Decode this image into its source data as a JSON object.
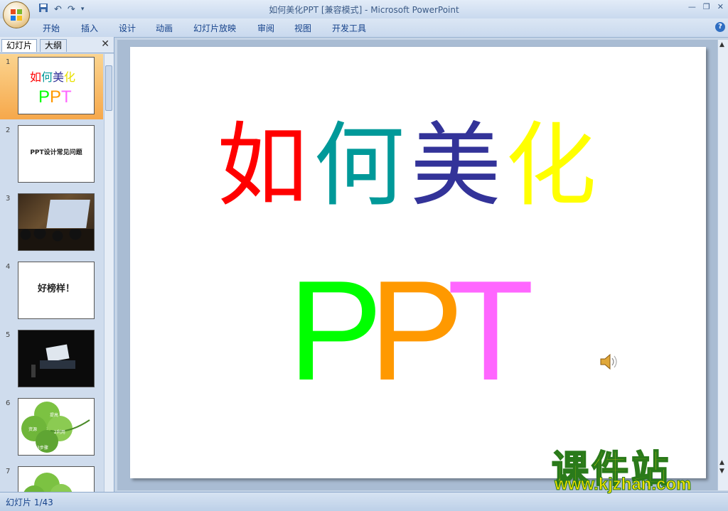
{
  "window": {
    "title": "如何美化PPT [兼容模式] - Microsoft PowerPoint",
    "controls": [
      "minimize",
      "restore",
      "close"
    ]
  },
  "quick_access": {
    "icons": [
      "save-icon",
      "undo-icon",
      "redo-icon",
      "customize-icon"
    ]
  },
  "ribbon": {
    "tabs": [
      "开始",
      "插入",
      "设计",
      "动画",
      "幻灯片放映",
      "审阅",
      "视图",
      "开发工具"
    ],
    "help_label": "?"
  },
  "panel": {
    "tabs": [
      "幻灯片",
      "大纲"
    ],
    "close_label": "✕",
    "slides": [
      {
        "num": "1",
        "selected": true
      },
      {
        "num": "2",
        "text": "PPT设计常见问题"
      },
      {
        "num": "3"
      },
      {
        "num": "4",
        "text": "好榜样！"
      },
      {
        "num": "5"
      },
      {
        "num": "6",
        "labels": [
          "提高",
          "资源",
          "2利用",
          "3步骤"
        ]
      },
      {
        "num": "7"
      }
    ]
  },
  "slide": {
    "line1": [
      "如",
      "何",
      "美",
      "化"
    ],
    "line1_colors": [
      "#ff0000",
      "#009999",
      "#333399",
      "#ffff00"
    ],
    "line2": [
      "P",
      "P",
      "T"
    ],
    "line2_colors": [
      "#00ff00",
      "#ff9900",
      "#ff66ff"
    ]
  },
  "status": {
    "text": "幻灯片 1/43"
  },
  "watermark": {
    "cn": "课件站",
    "url": "www.kjzhan.com"
  }
}
